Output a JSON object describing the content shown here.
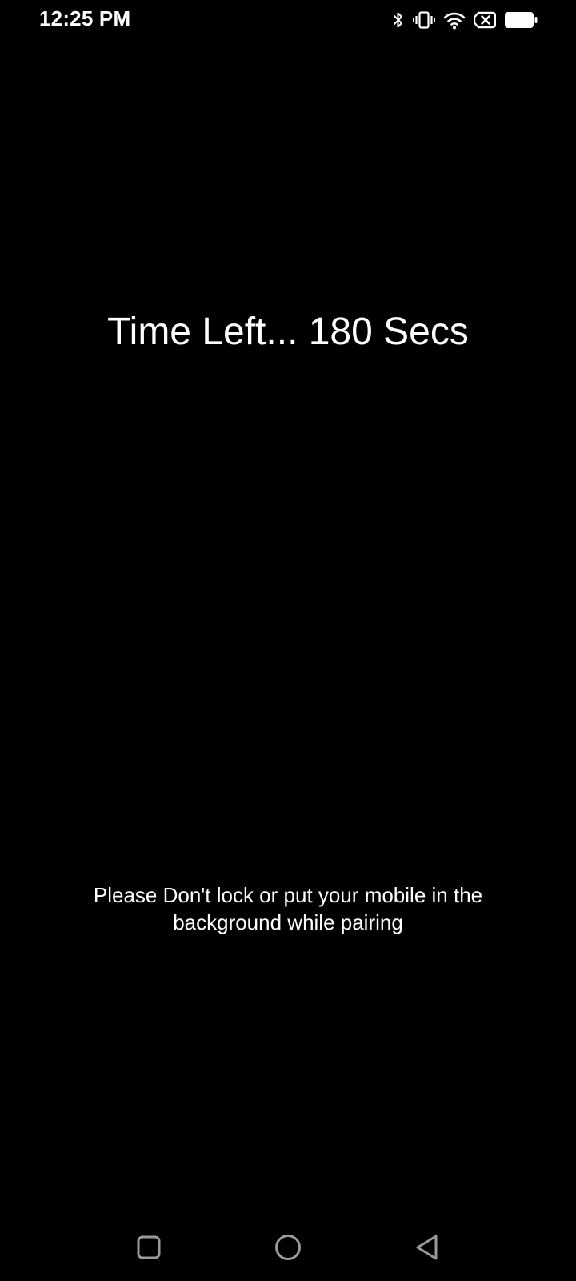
{
  "status_bar": {
    "time": "12:25 PM",
    "icons": [
      "bluetooth-icon",
      "vibrate-icon",
      "wifi-icon",
      "no-sim-icon",
      "battery-icon"
    ]
  },
  "main": {
    "timer_text": "Time Left... 180 Secs",
    "warning_text": "Please Don't lock or put your mobile in the background while pairing"
  },
  "nav_bar": {
    "icons": [
      "recent-apps-icon",
      "home-icon",
      "back-icon"
    ]
  },
  "colors": {
    "background": "#000000",
    "text": "#ffffff",
    "nav_icon": "#9a9a9a"
  }
}
